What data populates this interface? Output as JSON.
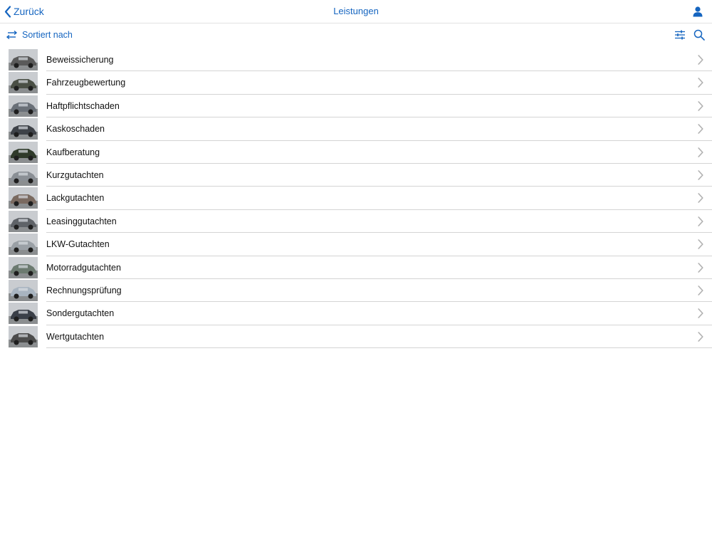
{
  "navbar": {
    "back_label": "Zurück",
    "title": "Leistungen",
    "back_icon": "chevron-left-icon",
    "profile_icon": "person-icon"
  },
  "toolbar": {
    "sort_label": "Sortiert nach",
    "sort_icon": "swap-arrows-icon",
    "filter_icon": "sliders-icon",
    "search_icon": "magnifier-icon"
  },
  "colors": {
    "accent": "#1565c0",
    "text": "#111111",
    "separator": "#d4d4d4",
    "chevron": "#b0b0b0"
  },
  "services": [
    {
      "label": "Beweissicherung",
      "thumb": "#5a5a5a"
    },
    {
      "label": "Fahrzeugbewertung",
      "thumb": "#4a4f45"
    },
    {
      "label": "Haftpflichtschaden",
      "thumb": "#6a7078"
    },
    {
      "label": "Kaskoschaden",
      "thumb": "#3e4248"
    },
    {
      "label": "Kaufberatung",
      "thumb": "#2f3a2a"
    },
    {
      "label": "Kurzgutachten",
      "thumb": "#8a8f95"
    },
    {
      "label": "Lackgutachten",
      "thumb": "#7a6a60"
    },
    {
      "label": "Leasinggutachten",
      "thumb": "#5f6368"
    },
    {
      "label": "LKW-Gutachten",
      "thumb": "#9aa0a6"
    },
    {
      "label": "Motorradgutachten",
      "thumb": "#6c7a70"
    },
    {
      "label": "Rechnungsprüfung",
      "thumb": "#a8b4c0"
    },
    {
      "label": "Sondergutachten",
      "thumb": "#3a3f48"
    },
    {
      "label": "Wertgutachten",
      "thumb": "#4c4c4c"
    }
  ]
}
